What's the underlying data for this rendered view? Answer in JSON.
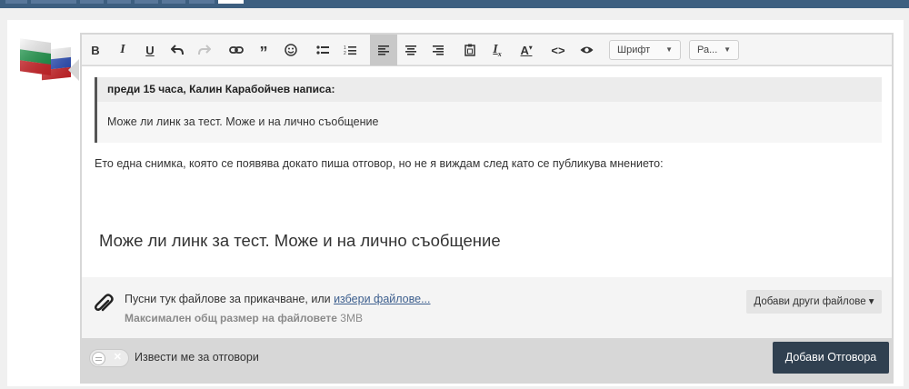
{
  "toolbar": {
    "font_select": "Шрифт",
    "size_select": "Ра..."
  },
  "quote": {
    "header": "преди 15 часа, Калин Карабойчев написа:",
    "body": "Може ли линк за тест. Може и на лично съобщение"
  },
  "content": {
    "paragraph": "Ето  една снимка, която се появява докато пиша отговор, но не я виждам след като се публикува мнението:",
    "image_text": "Може ли линк за тест. Може и на лично съобщение"
  },
  "attachments": {
    "prompt": "Пусни тук файлове за прикачване, или",
    "choose_link": "избери файлове...",
    "max_label": "Максимален общ размер на файловете",
    "max_value": "3MB",
    "more_button": "Добави други файлове ▾"
  },
  "footer": {
    "notify_label": "Извести ме за отговори",
    "submit_label": "Добави Отговора"
  },
  "colors": {
    "topbar": "#3d5f80",
    "submit": "#304050",
    "link": "#3d5f8e"
  },
  "icons": [
    "bold-icon",
    "italic-icon",
    "underline-icon",
    "undo-icon",
    "redo-icon",
    "link-icon",
    "quote-icon",
    "emoji-icon",
    "bullet-list-icon",
    "numbered-list-icon",
    "align-left-icon",
    "align-center-icon",
    "align-right-icon",
    "paste-icon",
    "clear-format-icon",
    "text-color-icon",
    "source-code-icon",
    "preview-icon",
    "paperclip-icon",
    "flag-avatar"
  ]
}
